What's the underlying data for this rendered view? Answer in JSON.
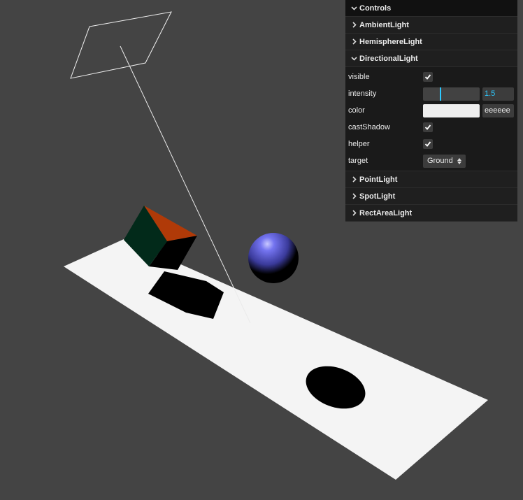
{
  "gui": {
    "title": "Controls",
    "folders": [
      {
        "label": "AmbientLight",
        "expanded": false
      },
      {
        "label": "HemisphereLight",
        "expanded": false
      },
      {
        "label": "DirectionalLight",
        "expanded": true
      },
      {
        "label": "PointLight",
        "expanded": false
      },
      {
        "label": "SpotLight",
        "expanded": false
      },
      {
        "label": "RectAreaLight",
        "expanded": false
      }
    ],
    "directional": {
      "visible_label": "visible",
      "visible": true,
      "intensity_label": "intensity",
      "intensity": "1.5",
      "intensity_fraction": 0.3,
      "color_label": "color",
      "color_value": "eeeeee",
      "color_hex": "#eeeeee",
      "castShadow_label": "castShadow",
      "castShadow": true,
      "helper_label": "helper",
      "helper": true,
      "target_label": "target",
      "target_value": "Ground"
    }
  },
  "colors": {
    "background": "#444444",
    "panel": "#1a1a1a",
    "accent": "#2cc9ff",
    "ground": "#f4f4f4",
    "sphere": "#6b6bf0",
    "cube_front": "#022a1a",
    "cube_top": "#b03a08"
  },
  "scene": {
    "objects": [
      "directional-light-helper",
      "cube",
      "sphere",
      "ground-plane",
      "cube-shadow",
      "sphere-shadow"
    ]
  }
}
